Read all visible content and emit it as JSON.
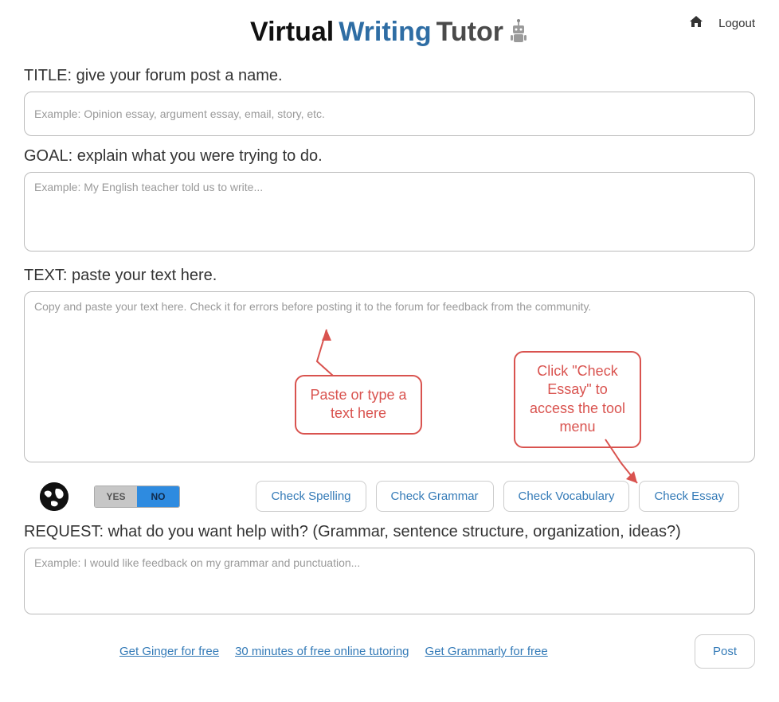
{
  "header": {
    "logo_w1": "Virtual",
    "logo_w2": "Writing",
    "logo_w3": "Tutor",
    "logout": "Logout"
  },
  "sections": {
    "title_label": "TITLE: give your forum post a name.",
    "title_placeholder": "Example: Opinion essay, argument essay, email, story, etc.",
    "goal_label": "GOAL: explain what you were trying to do.",
    "goal_placeholder": "Example: My English teacher told us to write...",
    "text_label": "TEXT: paste your text here.",
    "text_placeholder": "Copy and paste your text here. Check it for errors before posting it to the forum for feedback from the community.",
    "request_label": "REQUEST: what do you want help with? (Grammar, sentence structure, organization, ideas?)",
    "request_placeholder": "Example: I would like feedback on my grammar and punctuation..."
  },
  "callouts": {
    "paste_text": "Paste or type a text here",
    "check_essay": "Click \"Check Essay\" to access the tool menu"
  },
  "toolbar": {
    "toggle_yes": "YES",
    "toggle_no": "NO",
    "check_spelling": "Check Spelling",
    "check_grammar": "Check Grammar",
    "check_vocabulary": "Check Vocabulary",
    "check_essay": "Check Essay"
  },
  "footer": {
    "link_ginger": "Get Ginger for free",
    "link_tutoring": "30 minutes of free online tutoring",
    "link_grammarly": "Get Grammarly for free",
    "post": "Post"
  }
}
